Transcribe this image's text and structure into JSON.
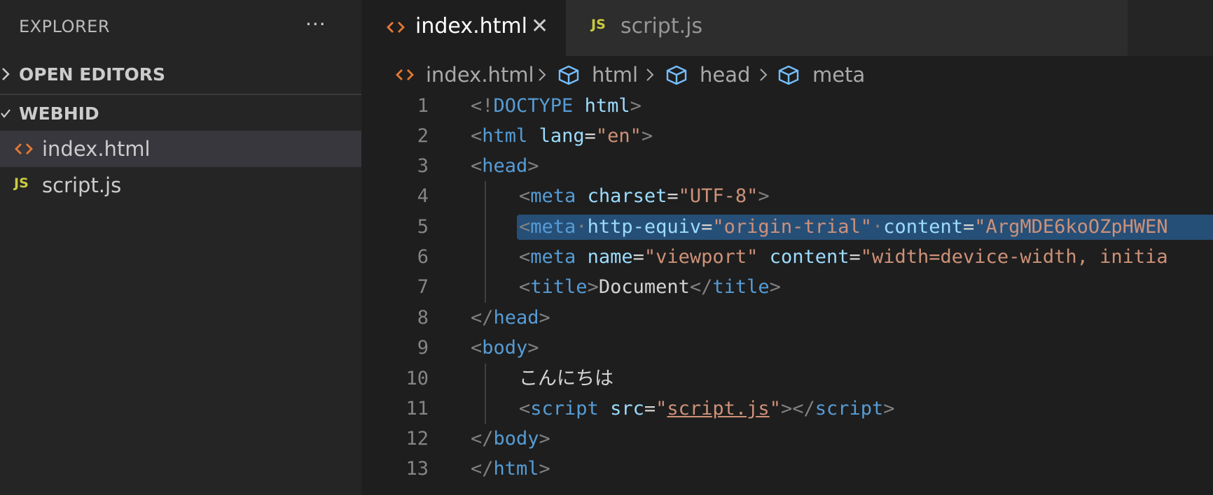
{
  "sidebar": {
    "title": "EXPLORER",
    "more": "···",
    "sections": [
      {
        "label": "OPEN EDITORS",
        "expanded": false
      },
      {
        "label": "WEBHID",
        "expanded": true
      }
    ],
    "files": [
      {
        "name": "index.html",
        "icon": "html-file-icon",
        "active": true
      },
      {
        "name": "script.js",
        "icon": "js-file-icon",
        "badge": "JS",
        "active": false
      }
    ]
  },
  "tabs": [
    {
      "label": "index.html",
      "icon": "html-file-icon",
      "active": true,
      "close": "✕"
    },
    {
      "label": "script.js",
      "icon": "js-file-icon",
      "badge": "JS",
      "active": false
    }
  ],
  "breadcrumb": [
    {
      "label": "index.html",
      "icon": "html-file-icon"
    },
    {
      "label": "html",
      "icon": "symbol-cube-icon"
    },
    {
      "label": "head",
      "icon": "symbol-cube-icon"
    },
    {
      "label": "meta",
      "icon": "symbol-cube-icon"
    }
  ],
  "line_numbers": [
    "1",
    "2",
    "3",
    "4",
    "5",
    "6",
    "7",
    "8",
    "9",
    "10",
    "11",
    "12",
    "13"
  ],
  "code": {
    "l1": {
      "a": "<!",
      "b": "DOCTYPE",
      "c": " ",
      "d": "html",
      "e": ">"
    },
    "l2": {
      "a": "<",
      "b": "html",
      "c": " ",
      "d": "lang",
      "e": "=",
      "f": "\"en\"",
      "g": ">"
    },
    "l3": {
      "a": "<",
      "b": "head",
      "c": ">"
    },
    "l4": {
      "a": "<",
      "b": "meta",
      "c": " ",
      "d": "charset",
      "e": "=",
      "f": "\"UTF-8\"",
      "g": ">"
    },
    "l5": {
      "a": "<",
      "b": "meta",
      "c": "·",
      "d": "http-equiv",
      "e": "=",
      "f": "\"origin-trial\"",
      "g": "·",
      "h": "content",
      "i": "=",
      "j": "\"ArgMDE6koOZpHWEN"
    },
    "l6": {
      "a": "<",
      "b": "meta",
      "c": " ",
      "d": "name",
      "e": "=",
      "f": "\"viewport\"",
      "g": " ",
      "h": "content",
      "i": "=",
      "j": "\"width=device-width, initia"
    },
    "l7": {
      "a": "<",
      "b": "title",
      "c": ">",
      "d": "Document",
      "e": "</",
      "f": "title",
      "g": ">"
    },
    "l8": {
      "a": "</",
      "b": "head",
      "c": ">"
    },
    "l9": {
      "a": "<",
      "b": "body",
      "c": ">"
    },
    "l10": {
      "a": "こんにちは"
    },
    "l11": {
      "a": "<",
      "b": "script",
      "c": " ",
      "d": "src",
      "e": "=",
      "f": "\"",
      "g": "script.js",
      "h": "\"",
      "i": "></",
      "j": "script",
      "k": ">"
    },
    "l12": {
      "a": "</",
      "b": "body",
      "c": ">"
    },
    "l13": {
      "a": "</",
      "b": "html",
      "c": ">"
    }
  },
  "colors": {
    "tag": "#569cd6",
    "attribute": "#9cdcfe",
    "string": "#ce9178",
    "punctuation": "#808080",
    "selection": "#264f78",
    "html_icon": "#e37933",
    "js_badge": "#cbcb41",
    "symbol_icon": "#75beff"
  }
}
